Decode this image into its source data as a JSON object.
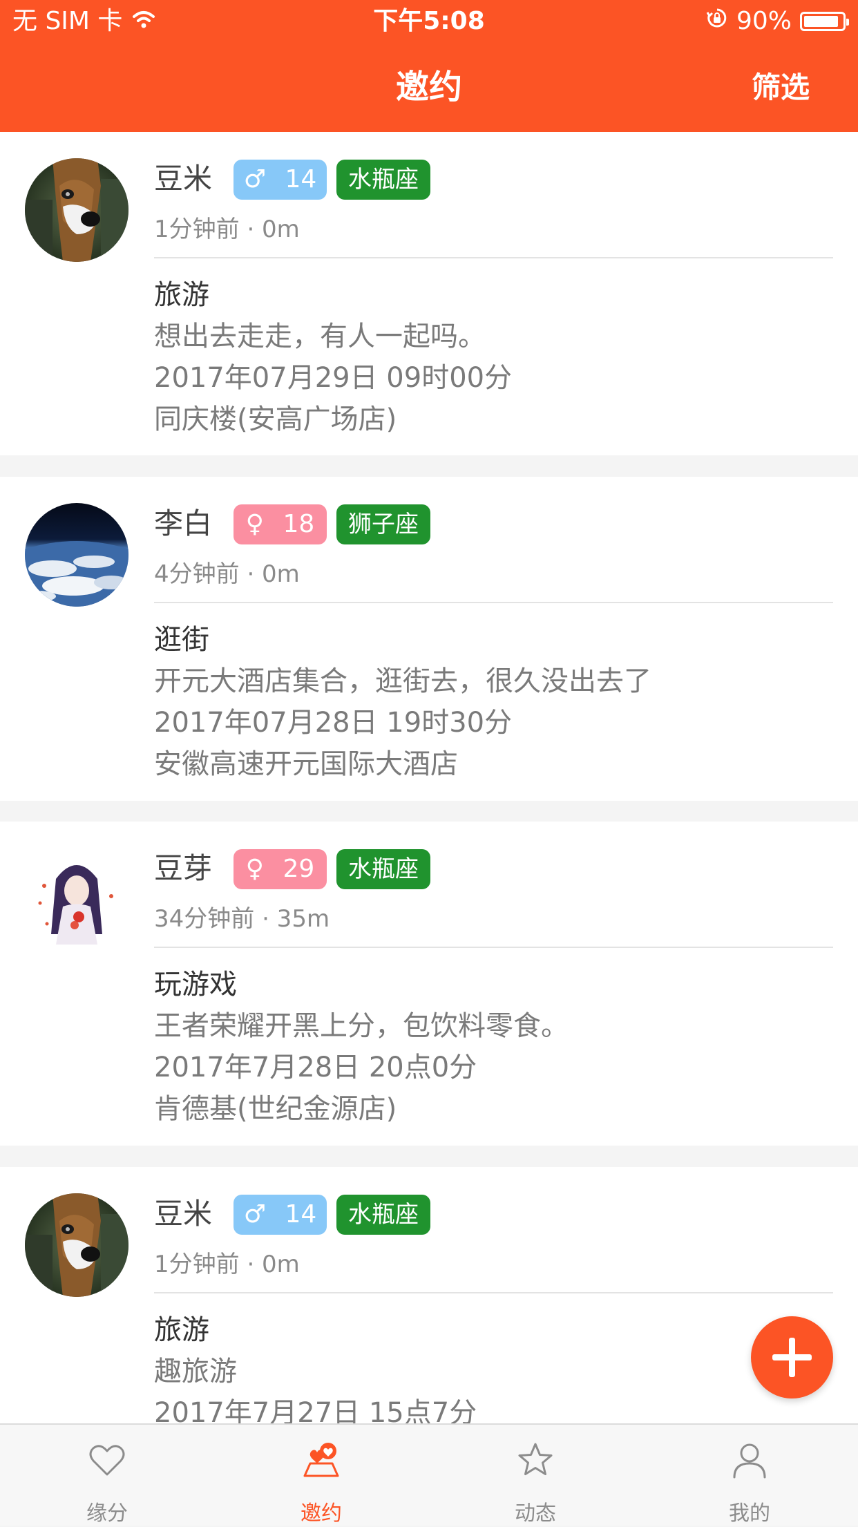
{
  "status_bar": {
    "carrier": "无 SIM 卡",
    "time": "下午5:08",
    "battery": "90%",
    "battery_level": 0.9
  },
  "nav": {
    "title": "邀约",
    "filter": "筛选"
  },
  "posts": [
    {
      "name": "豆米",
      "gender_symbol": "♂",
      "age": "14",
      "gender": "male",
      "zodiac": "水瓶座",
      "meta": "1分钟前 · 0m",
      "activity": "旅游",
      "description": "想出去走走，有人一起吗。",
      "datetime": "2017年07月29日 09时00分",
      "location": "同庆楼(安高广场店)",
      "avatar_icon": "dog-avatar"
    },
    {
      "name": "李白",
      "gender_symbol": "♀",
      "age": "18",
      "gender": "female",
      "zodiac": "狮子座",
      "meta": "4分钟前 · 0m",
      "activity": "逛街",
      "description": "开元大酒店集合，逛街去，很久没出去了",
      "datetime": "2017年07月28日 19时30分",
      "location": "安徽高速开元国际大酒店",
      "avatar_icon": "earth-avatar"
    },
    {
      "name": "豆芽",
      "gender_symbol": "♀",
      "age": "29",
      "gender": "female",
      "zodiac": "水瓶座",
      "meta": "34分钟前 · 35m",
      "activity": "玩游戏",
      "description": "王者荣耀开黑上分，包饮料零食。",
      "datetime": "2017年7月28日 20点0分",
      "location": "肯德基(世纪金源店)",
      "avatar_icon": "anime-girl-avatar"
    },
    {
      "name": "豆米",
      "gender_symbol": "♂",
      "age": "14",
      "gender": "male",
      "zodiac": "水瓶座",
      "meta": "1分钟前 · 0m",
      "activity": "旅游",
      "description": "趣旅游",
      "datetime": "2017年7月27日 15点7分",
      "location": "",
      "avatar_icon": "dog-avatar"
    }
  ],
  "tabs": [
    {
      "label": "缘分",
      "icon": "heart-icon",
      "active": false
    },
    {
      "label": "邀约",
      "icon": "map-heart-icon",
      "active": true
    },
    {
      "label": "动态",
      "icon": "star-icon",
      "active": false
    },
    {
      "label": "我的",
      "icon": "user-icon",
      "active": false
    }
  ],
  "colors": {
    "brand": "#fc5425",
    "male_badge": "#87c8f8",
    "female_badge": "#fb8fa1",
    "zodiac_badge": "#20932e"
  }
}
